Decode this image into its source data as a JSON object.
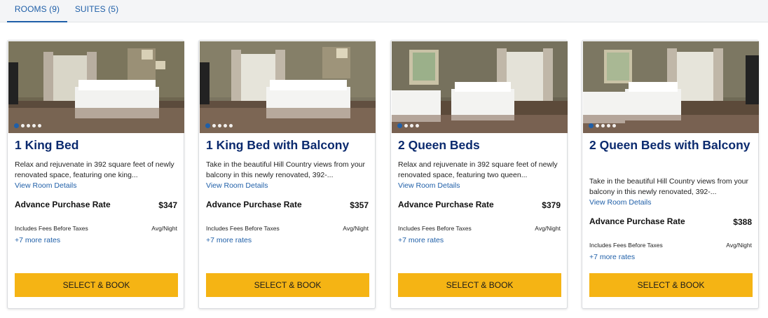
{
  "tabs": [
    {
      "label": "ROOMS (9)",
      "active": true
    },
    {
      "label": "SUITES (5)",
      "active": false
    }
  ],
  "colors": {
    "accent_blue": "#1f5fa8",
    "title_navy": "#0b2a6e",
    "button_yellow": "#f5b414"
  },
  "rooms": [
    {
      "title": "1 King Bed",
      "description": "Relax and rejuvenate in 392 square feet of newly renovated space, featuring one king...",
      "details_link": "View Room Details",
      "rate_name": "Advance Purchase Rate",
      "price": "$347",
      "fees_note": "Includes Fees Before Taxes",
      "price_unit": "Avg/Night",
      "more_rates": "+7 more rates",
      "button": "SELECT & BOOK",
      "photo_count": 5,
      "photo_index": 1
    },
    {
      "title": "1 King Bed with Balcony",
      "description": "Take in the beautiful Hill Country views from your balcony in this newly renovated, 392-...",
      "details_link": "View Room Details",
      "rate_name": "Advance Purchase Rate",
      "price": "$357",
      "fees_note": "Includes Fees Before Taxes",
      "price_unit": "Avg/Night",
      "more_rates": "+7 more rates",
      "button": "SELECT & BOOK",
      "photo_count": 5,
      "photo_index": 1
    },
    {
      "title": "2 Queen Beds",
      "description": "Relax and rejuvenate in 392 square feet of newly renovated space, featuring two queen...",
      "details_link": "View Room Details",
      "rate_name": "Advance Purchase Rate",
      "price": "$379",
      "fees_note": "Includes Fees Before Taxes",
      "price_unit": "Avg/Night",
      "more_rates": "+7 more rates",
      "button": "SELECT & BOOK",
      "photo_count": 4,
      "photo_index": 1
    },
    {
      "title": "2 Queen Beds with Balcony",
      "description": "Take in the beautiful Hill Country views from your balcony in this newly renovated, 392-...",
      "details_link": "View Room Details",
      "rate_name": "Advance Purchase Rate",
      "price": "$388",
      "fees_note": "Includes Fees Before Taxes",
      "price_unit": "Avg/Night",
      "more_rates": "+7 more rates",
      "button": "SELECT & BOOK",
      "photo_count": 5,
      "photo_index": 1
    }
  ]
}
